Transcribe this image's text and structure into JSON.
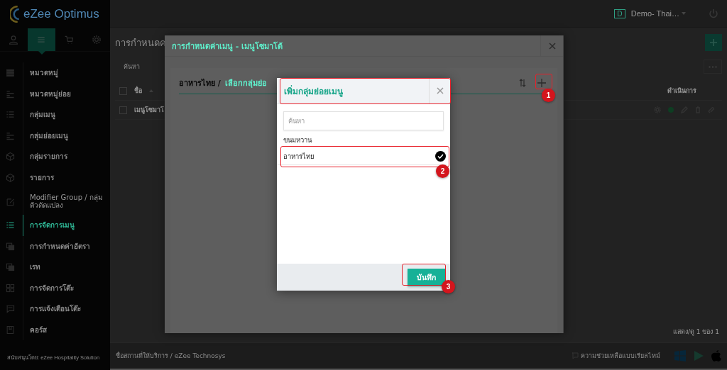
{
  "sidebar": {
    "logo": "eZee Optimus",
    "tabs": [
      {
        "selected": false
      },
      {
        "selected": true
      },
      {
        "selected": false
      },
      {
        "selected": false
      }
    ],
    "items": [
      {
        "label": "หมวดหมู่",
        "selected": false
      },
      {
        "label": "หมวดหมู่ย่อย",
        "selected": false
      },
      {
        "label": "กลุ่มเมนู",
        "selected": false
      },
      {
        "label": "กลุ่มย่อยเมนู",
        "selected": false
      },
      {
        "label": "กลุ่มรายการ",
        "selected": false
      },
      {
        "label": "รายการ",
        "selected": false
      },
      {
        "label": "Modifier Group / กลุ่มตัวดัดแปลง",
        "selected": false
      },
      {
        "label": "การจัดการเมนู",
        "selected": true
      },
      {
        "label": "การกำหนดค่าอัตรา",
        "selected": false
      },
      {
        "label": "เรท",
        "selected": false
      },
      {
        "label": "การจัดการโต๊ะ",
        "selected": false
      },
      {
        "label": "การแจ้งเตือนโต๊ะ",
        "selected": false
      },
      {
        "label": "คอร์ส",
        "selected": false
      }
    ],
    "footer": "สนับสนุนโดย: eZee Hospitality Solution"
  },
  "topbar": {
    "property_initial": "D",
    "property": "Demo- Thai…"
  },
  "page": {
    "title": "การกำหนดค",
    "search": {
      "placeholder": "ค้นหา"
    },
    "table": {
      "all_checked": false,
      "columns": [
        "ชื่อ",
        "ดำเนินการ"
      ],
      "rows": [
        {
          "name": "เมนูโซมาโ",
          "checked": false,
          "active": true
        }
      ]
    },
    "pagination": "แสดง/ดู 1 ของ 1"
  },
  "status_bar": {
    "location": "ชื่อสถานที่ให้บริการ / eZee Technosys",
    "help": "ความช่วยเหลือแบบเรียลไทม์"
  },
  "menu_dialog": {
    "title": "การกำหนดค่าเมนู - เมนูโซมาโต้",
    "breadcrumb": "อาหารไทย /",
    "current": "เลือกกลุ่มย่อ"
  },
  "subgroup_dialog": {
    "title": "เพิ่มกลุ่มย่อยเมนู",
    "search": {
      "placeholder": "ค้นหา"
    },
    "groups": [
      {
        "label": "ขนมหวาน",
        "options": [
          {
            "label": "อาหารไทย",
            "selected": true
          }
        ]
      }
    ],
    "save": "บันทึก"
  },
  "annotations": [
    {
      "number": "1"
    },
    {
      "number": "2"
    },
    {
      "number": "3"
    }
  ]
}
